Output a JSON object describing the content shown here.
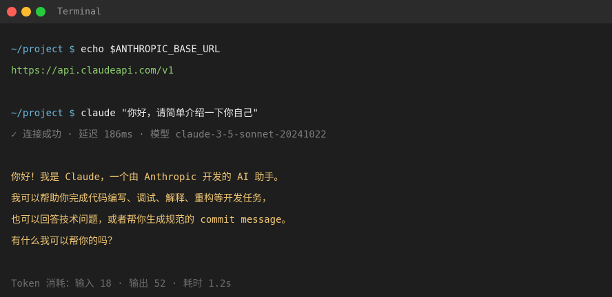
{
  "window": {
    "title": "Terminal"
  },
  "terminal": {
    "lines": [
      {
        "type": "command",
        "path": "~/project",
        "dollar": "$",
        "command": "echo $ANTHROPIC_BASE_URL"
      },
      {
        "type": "output_url",
        "text": "https://api.claudeapi.com/v1"
      },
      {
        "type": "command",
        "path": "~/project",
        "dollar": "$",
        "command": "claude \"你好，请简单介绍一下你自己\""
      },
      {
        "type": "status",
        "text": "✓ 连接成功 · 延迟 186ms · 模型 claude-3-5-sonnet-20241022"
      },
      {
        "type": "reply",
        "text": "你好！我是 Claude，一个由 Anthropic 开发的 AI 助手。"
      },
      {
        "type": "reply",
        "text": "我可以帮助你完成代码编写、调试、解释、重构等开发任务，"
      },
      {
        "type": "reply",
        "text": "也可以回答技术问题，或者帮你生成规范的 commit message。"
      },
      {
        "type": "reply",
        "text": "有什么我可以帮你的吗？"
      },
      {
        "type": "meta",
        "text": "Token 消耗：输入 18 · 输出 52 · 耗时 1.2s"
      }
    ]
  },
  "colors": {
    "background": "#1e1e1e",
    "titlebar": "#2b2b2b",
    "close": "#ff5f56",
    "minimize": "#ffbd2e",
    "maximize": "#27c93f",
    "prompt": "#6cb6d9",
    "url": "#89c96a",
    "reply": "#f0c674",
    "muted": "#7d7d7d"
  }
}
